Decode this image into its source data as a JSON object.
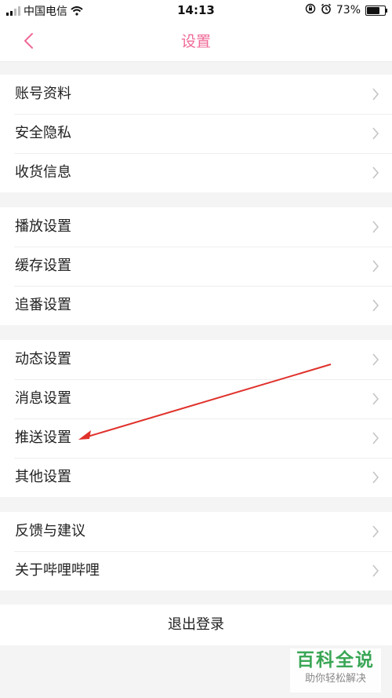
{
  "status_bar": {
    "carrier": "中国电信",
    "time": "14:13",
    "battery_pct": "73%",
    "icons": [
      "signal-icon",
      "wifi-icon",
      "rotation-lock-icon",
      "alarm-icon",
      "battery-icon"
    ]
  },
  "nav": {
    "title": "设置",
    "back_icon": "chevron-left-icon"
  },
  "colors": {
    "accent": "#f06a98",
    "annotation": "#e0312b",
    "watermark": "#3aa655"
  },
  "groups": [
    {
      "items": [
        {
          "label": "账号资料"
        },
        {
          "label": "安全隐私"
        },
        {
          "label": "收货信息"
        }
      ]
    },
    {
      "items": [
        {
          "label": "播放设置"
        },
        {
          "label": "缓存设置"
        },
        {
          "label": "追番设置"
        }
      ]
    },
    {
      "items": [
        {
          "label": "动态设置"
        },
        {
          "label": "消息设置"
        },
        {
          "label": "推送设置"
        },
        {
          "label": "其他设置"
        }
      ]
    },
    {
      "items": [
        {
          "label": "反馈与建议"
        },
        {
          "label": "关于哔哩哔哩"
        }
      ]
    }
  ],
  "logout_label": "退出登录",
  "watermark": {
    "title": "百科全说",
    "subtitle": "助你轻松解决"
  }
}
